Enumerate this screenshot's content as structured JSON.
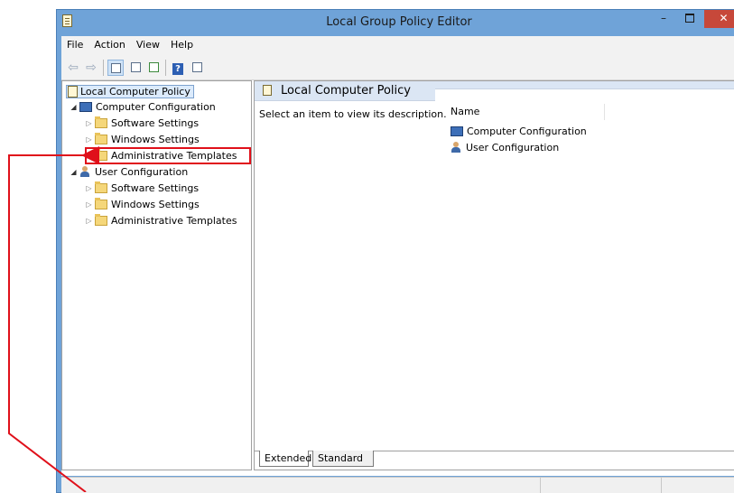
{
  "window": {
    "title": "Local Group Policy Editor",
    "minimize": "–",
    "close": "✕"
  },
  "menu": {
    "items": [
      "File",
      "Action",
      "View",
      "Help"
    ]
  },
  "toolbar": {
    "back": "⇦",
    "forward": "⇨"
  },
  "tree": {
    "root": "Local Computer Policy",
    "computer_config": "Computer Configuration",
    "cc_software": "Software Settings",
    "cc_windows": "Windows Settings",
    "cc_admin": "Administrative Templates",
    "user_config": "User Configuration",
    "uc_software": "Software Settings",
    "uc_windows": "Windows Settings",
    "uc_admin": "Administrative Templates",
    "expand_collapsed": "▷",
    "expand_open": "◢"
  },
  "details": {
    "header": "Local Computer Policy",
    "description": "Select an item to view its description.",
    "column_name": "Name",
    "items": [
      "Computer Configuration",
      "User Configuration"
    ]
  },
  "tabs": {
    "extended": "Extended",
    "standard": "Standard"
  },
  "annotation": {
    "color": "#e0101a"
  }
}
